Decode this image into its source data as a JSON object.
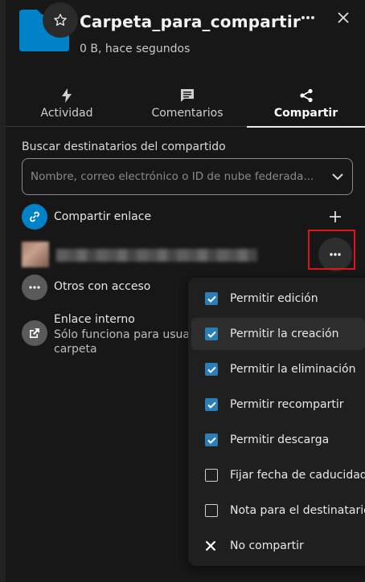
{
  "header": {
    "title": "Carpeta_para_compartir",
    "subtitle": "0 B, hace segundos",
    "folder_color": "#0082c9"
  },
  "tabs": [
    {
      "label": "Actividad",
      "icon": "bolt-icon",
      "active": false
    },
    {
      "label": "Comentarios",
      "icon": "comment-icon",
      "active": false
    },
    {
      "label": "Compartir",
      "icon": "share-icon",
      "active": true
    }
  ],
  "search": {
    "label": "Buscar destinatarios del compartido",
    "placeholder": "Nombre, correo electrónico o ID de nube federada..."
  },
  "share_link": {
    "label": "Compartir enlace",
    "icon_color": "#0082c9"
  },
  "others_access": {
    "label": "Otros con acceso"
  },
  "internal_link": {
    "title": "Enlace interno",
    "desc_line1": "Sólo funciona para usuari",
    "desc_line2": "carpeta"
  },
  "menu": {
    "items": [
      {
        "label": "Permitir edición",
        "checked": true
      },
      {
        "label": "Permitir la creación",
        "checked": true
      },
      {
        "label": "Permitir la eliminación",
        "checked": true
      },
      {
        "label": "Permitir recompartir",
        "checked": true
      },
      {
        "label": "Permitir descarga",
        "checked": true
      },
      {
        "label": "Fijar fecha de caducidad",
        "checked": false
      },
      {
        "label": "Nota para el destinatario",
        "checked": false
      }
    ],
    "unshare_label": "No compartir"
  },
  "colors": {
    "accent": "#0082c9",
    "checkbox": "#2a7fb8",
    "highlight": "#e0141b"
  }
}
